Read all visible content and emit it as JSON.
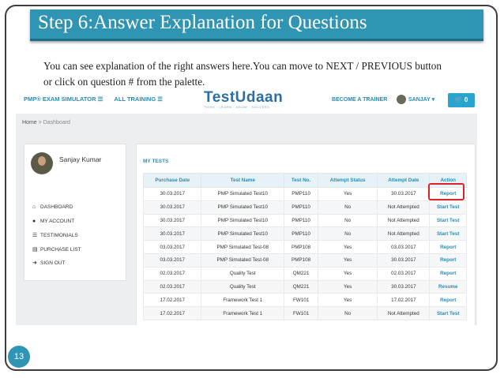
{
  "slide": {
    "title": "Step 6:Answer Explanation for Questions",
    "description_line1": "You can see explanation of the right answers here.You can move to NEXT / PREVIOUS button",
    "description_line2": "or click on question # from the palette.",
    "page_number": "13"
  },
  "app": {
    "nav": {
      "exam_simulator": "PMP® EXAM SIMULATOR ☰",
      "all_training": "ALL TRAINING ☰",
      "logo": "TestUdaan",
      "logo_tagline": "THINK · LEARN · GROW · SUCCEED",
      "become_trainer": "BECOME A TRAINER",
      "user_menu": "SANJAY ▾",
      "cart": "🛒 0"
    },
    "breadcrumb": {
      "home": "Home",
      "separator": ">",
      "current": "Dashboard"
    },
    "sidebar": {
      "user_name": "Sanjay Kumar",
      "items": [
        {
          "icon": "home-icon",
          "glyph": "⌂",
          "label": "DASHBOARD"
        },
        {
          "icon": "user-icon",
          "glyph": "●",
          "label": "MY ACCOUNT"
        },
        {
          "icon": "list-icon",
          "glyph": "☰",
          "label": "TESTIMONIALS"
        },
        {
          "icon": "document-icon",
          "glyph": "▤",
          "label": "PURCHASE LIST"
        },
        {
          "icon": "sign-out-icon",
          "glyph": "➜",
          "label": "SIGN OUT"
        }
      ]
    },
    "tests": {
      "title": "MY TESTS",
      "headers": [
        "Purchase Date",
        "Test Name",
        "Test No.",
        "Attempt Status",
        "Attempt Date",
        "Action"
      ],
      "rows": [
        [
          "30.03.2017",
          "PMP Simulated Test10",
          "PMP110",
          "Yes",
          "30.03.2017",
          "Report"
        ],
        [
          "30.03.2017",
          "PMP Simulated Test10",
          "PMP110",
          "No",
          "Not Attempted",
          "Start Test"
        ],
        [
          "30.03.2017",
          "PMP Simulated Test10",
          "PMP110",
          "No",
          "Not Attempted",
          "Start Test"
        ],
        [
          "30.03.2017",
          "PMP Simulated Test10",
          "PMP110",
          "No",
          "Not Attempted",
          "Start Test"
        ],
        [
          "03.03.2017",
          "PMP Simulated Test-08",
          "PMP108",
          "Yes",
          "03.03.2017",
          "Report"
        ],
        [
          "03.03.2017",
          "PMP Simulated Test-08",
          "PMP108",
          "Yes",
          "30.03.2017",
          "Report"
        ],
        [
          "02.03.2017",
          "Quality Test",
          "QM221",
          "Yes",
          "02.03.2017",
          "Report"
        ],
        [
          "02.03.2017",
          "Quality Test",
          "QM221",
          "Yes",
          "30.03.2017",
          "Resume"
        ],
        [
          "17.02.2017",
          "Framework Test 1",
          "FW101",
          "Yes",
          "17.02.2017",
          "Report"
        ],
        [
          "17.02.2017",
          "Framework Test 1",
          "FW101",
          "No",
          "Not Attempted",
          "Start Test"
        ]
      ]
    }
  },
  "colors": {
    "title_bar": "#2f95b3",
    "accent": "#2a8bb0",
    "highlight": "#d9252a"
  }
}
